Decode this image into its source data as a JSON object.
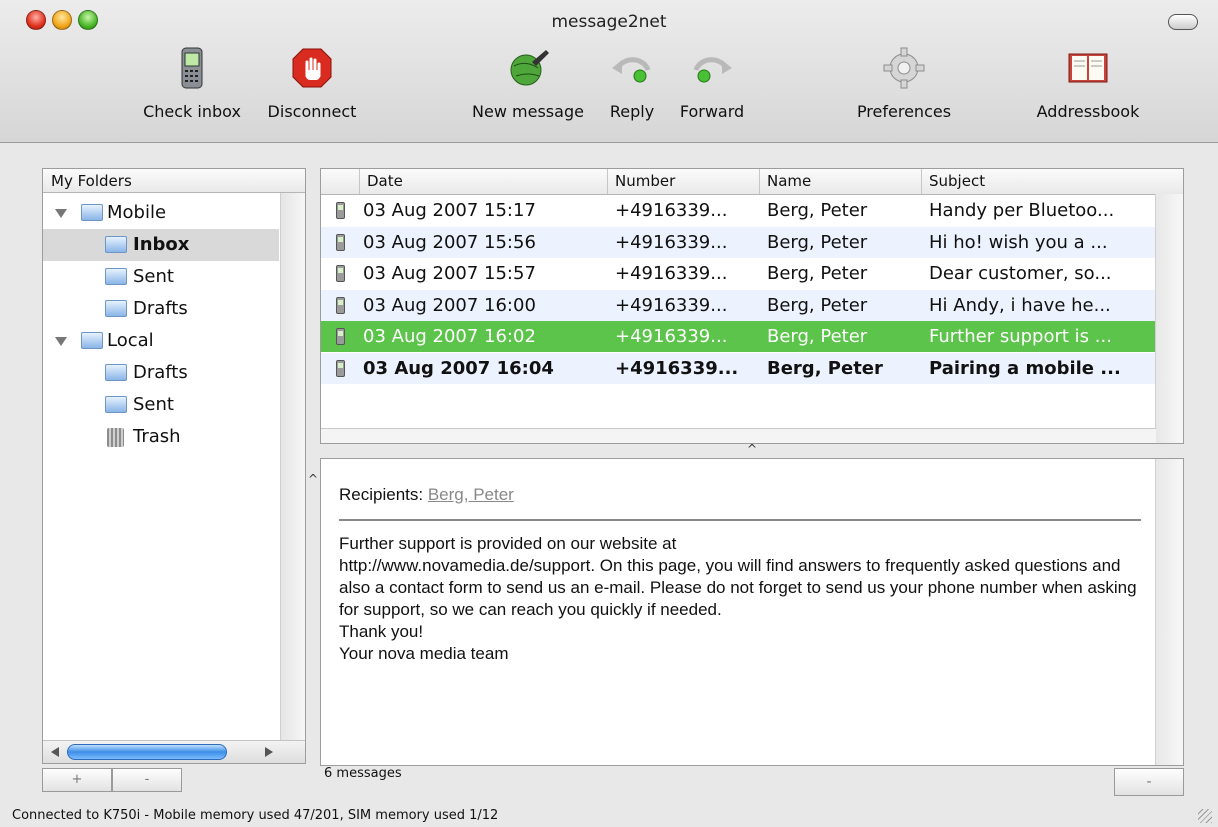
{
  "window": {
    "title": "message2net"
  },
  "toolbar": {
    "check_inbox": "Check inbox",
    "disconnect": "Disconnect",
    "new_message": "New message",
    "reply": "Reply",
    "forward": "Forward",
    "preferences": "Preferences",
    "addressbook": "Addressbook"
  },
  "folders": {
    "header": "My Folders",
    "items": [
      {
        "label": "Mobile"
      },
      {
        "label": "Inbox"
      },
      {
        "label": "Sent"
      },
      {
        "label": "Drafts"
      },
      {
        "label": "Local"
      },
      {
        "label": "Drafts"
      },
      {
        "label": "Sent"
      },
      {
        "label": "Trash"
      }
    ],
    "add_label": "+",
    "remove_label": "-"
  },
  "messages": {
    "columns": {
      "date": "Date",
      "number": "Number",
      "name": "Name",
      "subject": "Subject"
    },
    "rows": [
      {
        "date": "03 Aug 2007 15:17",
        "number": "+4916339...",
        "name": "Berg, Peter",
        "subject": "Handy per Bluetoo..."
      },
      {
        "date": "03 Aug 2007 15:56",
        "number": "+4916339...",
        "name": "Berg, Peter",
        "subject": "Hi ho! wish you a ..."
      },
      {
        "date": "03 Aug 2007 15:57",
        "number": "+4916339...",
        "name": "Berg, Peter",
        "subject": "Dear customer, so..."
      },
      {
        "date": "03 Aug 2007 16:00",
        "number": "+4916339...",
        "name": "Berg, Peter",
        "subject": "Hi Andy, i have he..."
      },
      {
        "date": "03 Aug 2007 16:02",
        "number": "+4916339...",
        "name": "Berg, Peter",
        "subject": "Further support is ..."
      },
      {
        "date": "03 Aug 2007 16:04",
        "number": "+4916339...",
        "name": "Berg, Peter",
        "subject": "Pairing a mobile ..."
      }
    ],
    "count": "6 messages",
    "splitter": "^"
  },
  "preview": {
    "recipients_label": "Recipients:",
    "recipients_name": "Berg, Peter",
    "body": "Further support is provided on our website at\nhttp://www.novamedia.de/support. On this page, you will find answers to frequently asked questions and also a contact form to send us an e-mail. Please do not forget to send us your phone number when asking for support, so we can reach you quickly if needed.\nThank you!\nYour nova media team"
  },
  "bottom": {
    "right_button": "-",
    "caret": "^"
  },
  "status": {
    "text": "Connected to K750i -  Mobile memory used 47/201, SIM memory used 1/12"
  },
  "colors": {
    "selection": "#5cc44a",
    "alt_row": "#edf3fe",
    "folder_selected": "#d9d9d9"
  }
}
